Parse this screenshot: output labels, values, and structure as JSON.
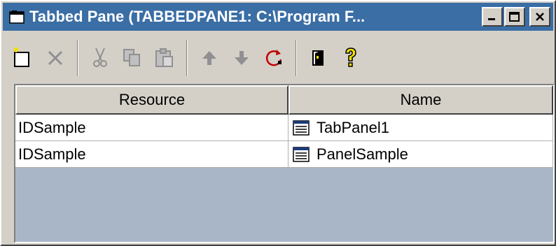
{
  "window": {
    "title": "Tabbed Pane (TABBEDPANE1: C:\\Program F..."
  },
  "toolbar": {
    "tools": [
      {
        "name": "new-icon",
        "enabled": true
      },
      {
        "name": "delete-icon",
        "enabled": false
      },
      {
        "name": "cut-icon",
        "enabled": false
      },
      {
        "name": "copy-icon",
        "enabled": false
      },
      {
        "name": "paste-icon",
        "enabled": false
      },
      {
        "name": "move-up-icon",
        "enabled": false
      },
      {
        "name": "move-down-icon",
        "enabled": false
      },
      {
        "name": "refresh-icon",
        "enabled": true
      },
      {
        "name": "properties-icon",
        "enabled": true
      },
      {
        "name": "help-icon",
        "enabled": true
      }
    ]
  },
  "table": {
    "columns": [
      "Resource",
      "Name"
    ],
    "rows": [
      {
        "resource": "IDSample",
        "name": "TabPanel1",
        "icon": "panel-icon"
      },
      {
        "resource": "IDSample",
        "name": "PanelSample",
        "icon": "panel-icon"
      }
    ]
  },
  "colors": {
    "titlebar": "#3a6ea5",
    "face": "#d4d0c8",
    "table_bg": "#a8b6c8"
  }
}
